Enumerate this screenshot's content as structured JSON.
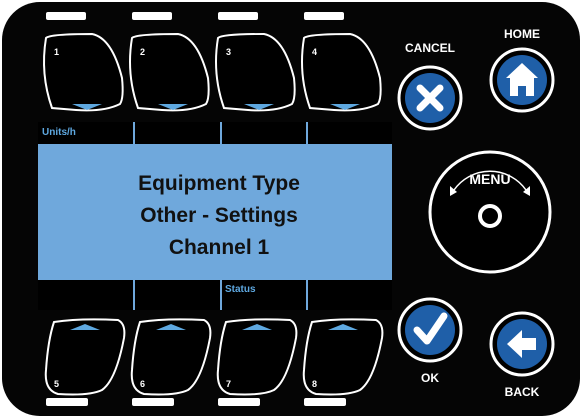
{
  "softkeys_top": [
    "1",
    "2",
    "3",
    "4"
  ],
  "softkeys_bottom": [
    "5",
    "6",
    "7",
    "8"
  ],
  "display": {
    "top_left_label": "Units/h",
    "bottom_label": "Status",
    "line1": "Equipment Type",
    "line2": "Other - Settings",
    "line3": "Channel 1",
    "background_color": "#6fa8dc"
  },
  "buttons": {
    "cancel_label": "CANCEL",
    "home_label": "HOME",
    "menu_label": "MENU",
    "ok_label": "OK",
    "back_label": "BACK",
    "button_color": "#1f5fa8"
  },
  "icons": {
    "cancel": "close-x-icon",
    "home": "house-icon",
    "menu": "rotary-knob-icon",
    "ok": "checkmark-icon",
    "back": "arrow-left-icon"
  }
}
